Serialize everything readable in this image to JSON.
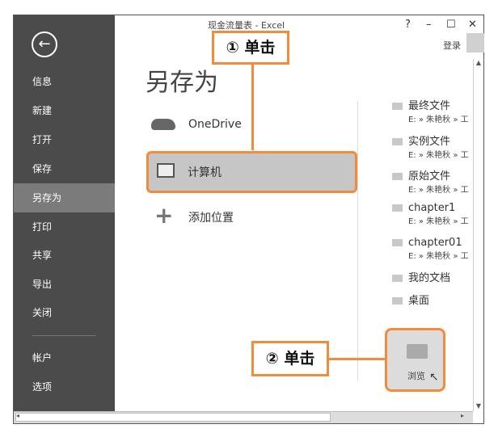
{
  "window": {
    "title": "现金流量表 - Excel",
    "help": "?",
    "minimize": "–",
    "maximize": "☐",
    "close": "✕",
    "login": "登录"
  },
  "sidebar": {
    "back_icon": "←",
    "items": [
      {
        "label": "信息"
      },
      {
        "label": "新建"
      },
      {
        "label": "打开"
      },
      {
        "label": "保存"
      },
      {
        "label": "另存为",
        "selected": true
      },
      {
        "label": "打印"
      },
      {
        "label": "共享"
      },
      {
        "label": "导出"
      },
      {
        "label": "关闭"
      },
      {
        "label": "帐户"
      },
      {
        "label": "选项"
      }
    ]
  },
  "main": {
    "heading": "另存为",
    "places": [
      {
        "label": "OneDrive",
        "icon": "cloud-icon"
      },
      {
        "label": "计算机",
        "icon": "computer-icon",
        "selected": true
      },
      {
        "label": "添加位置",
        "icon": "plus-icon"
      }
    ]
  },
  "recent": [
    {
      "name": "最终文件",
      "path": "E: » 朱艳秋 » 工"
    },
    {
      "name": "实例文件",
      "path": "E: » 朱艳秋 » 工"
    },
    {
      "name": "原始文件",
      "path": "E: » 朱艳秋 » 工"
    },
    {
      "name": "chapter1",
      "path": "E: » 朱艳秋 » 工"
    },
    {
      "name": "chapter01",
      "path": "E: » 朱艳秋 » 工"
    },
    {
      "name": "我的文档"
    },
    {
      "name": "桌面"
    }
  ],
  "browse": {
    "label": "浏览"
  },
  "annotations": {
    "step1": "① 单击",
    "step2": "② 单击",
    "color": "#f28b3c"
  }
}
